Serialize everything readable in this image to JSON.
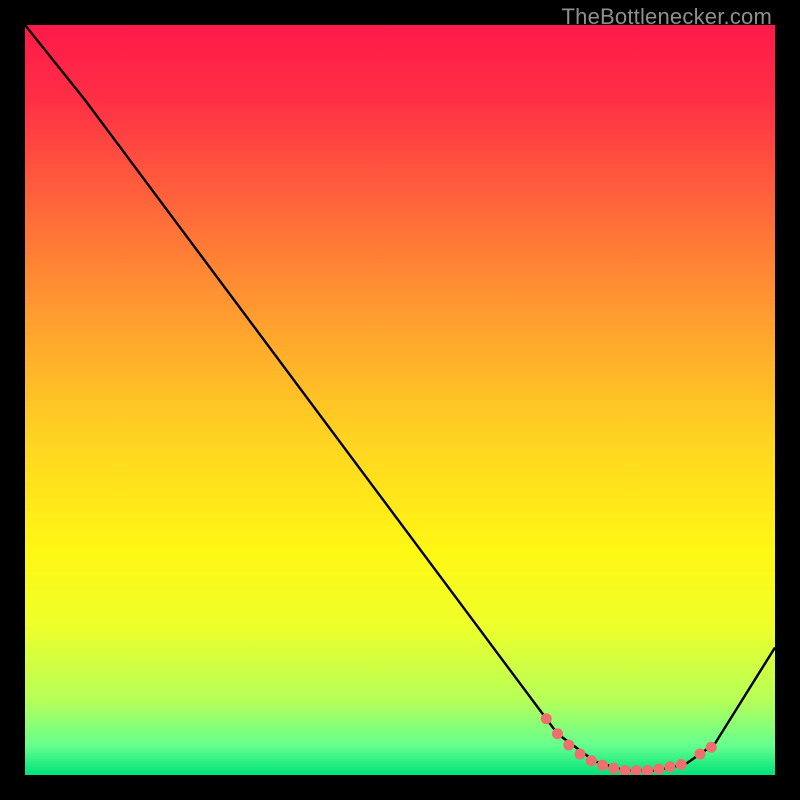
{
  "watermark": "TheBottlenecker.com",
  "chart_data": {
    "type": "line",
    "title": "",
    "xlabel": "",
    "ylabel": "",
    "xlim": [
      0,
      100
    ],
    "ylim": [
      0,
      100
    ],
    "grid": false,
    "background_gradient": {
      "stops": [
        {
          "offset": 0.0,
          "color": "#ff1a49"
        },
        {
          "offset": 0.1,
          "color": "#ff2f45"
        },
        {
          "offset": 0.25,
          "color": "#ff6a3a"
        },
        {
          "offset": 0.4,
          "color": "#ffa12e"
        },
        {
          "offset": 0.55,
          "color": "#ffd321"
        },
        {
          "offset": 0.7,
          "color": "#fff714"
        },
        {
          "offset": 0.8,
          "color": "#eeff2a"
        },
        {
          "offset": 0.9,
          "color": "#b6ff58"
        },
        {
          "offset": 0.96,
          "color": "#66ff8e"
        },
        {
          "offset": 1.0,
          "color": "#00e27a"
        }
      ]
    },
    "series": [
      {
        "name": "bottleneck-curve",
        "stroke": "#000000",
        "x": [
          0,
          8,
          71,
          76,
          80,
          84,
          88,
          92,
          100
        ],
        "y": [
          100,
          90,
          5.5,
          1.8,
          0.6,
          0.6,
          1.4,
          4.2,
          17
        ]
      }
    ],
    "markers": {
      "name": "highlight-range",
      "color": "#ef6f6f",
      "x": [
        69.5,
        71,
        72.5,
        74,
        75.5,
        77,
        78.5,
        80,
        81.5,
        83,
        84.5,
        86,
        87.5,
        90,
        91.5
      ],
      "y": [
        7.5,
        5.5,
        4.0,
        2.8,
        1.9,
        1.3,
        0.9,
        0.6,
        0.6,
        0.6,
        0.8,
        1.1,
        1.4,
        2.8,
        3.7
      ]
    }
  }
}
